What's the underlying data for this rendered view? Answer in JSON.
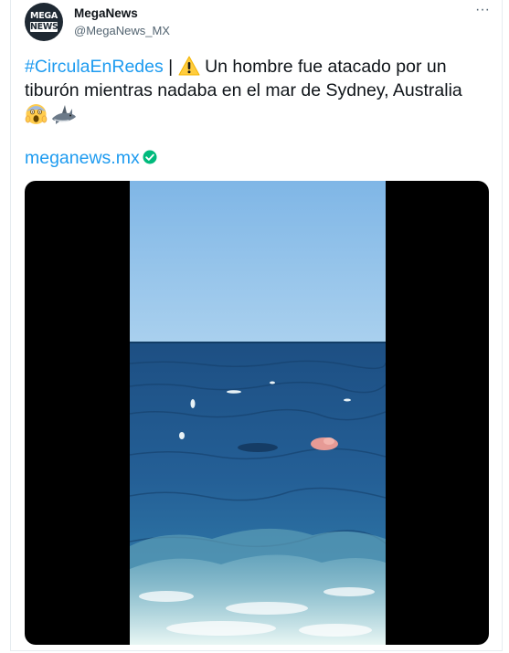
{
  "account": {
    "avatar_line1": "MEGA",
    "avatar_line2": "NEWS",
    "display_name": "MegaNews",
    "handle": "@MegaNews_MX"
  },
  "menu": {
    "more_label": "···"
  },
  "tweet": {
    "hashtag": "#CirculaEnRedes",
    "separator": " | ",
    "text_after_icon": " Un hombre fue atacado por un tiburón mientras nadaba en el mar de Sydney, Australia",
    "warning_icon": "warning-icon",
    "emojis": [
      "screaming-face-icon",
      "shark-icon"
    ],
    "link": "meganews.mx",
    "link_icon": "check-circle-icon",
    "link_icon_color": "#00ba7c"
  },
  "media": {
    "type": "video",
    "scene": "ocean-shark-attack-icon"
  },
  "colors": {
    "accent": "#1d9bf0",
    "text": "#0f1419",
    "secondary": "#536471"
  }
}
